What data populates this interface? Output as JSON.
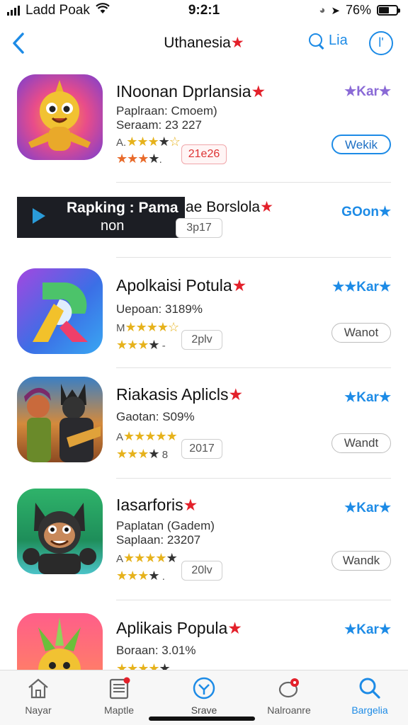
{
  "status": {
    "carrier": "Ladd Poak",
    "time": "9:2:1",
    "battery": "76%"
  },
  "nav": {
    "title": "Uthanesia",
    "search_label": "Lia"
  },
  "apps": [
    {
      "title": "INoonan Dprlansia",
      "sub1": "Paplraan: Cmoem)",
      "sub2": "Seraam: 23 227",
      "stars_prefix": "A.",
      "pill": "21e26",
      "rating": "Kar",
      "button": "Wekik"
    },
    {
      "banner_line1": "Rapking : Pama",
      "banner_line2": "non",
      "title": "ae Borslola",
      "pill": "3p17",
      "rating": "GOon"
    },
    {
      "title": "Apolkaisi Potula",
      "sub1": "Uepoan: 3189%",
      "stars_prefix": "M",
      "pill": "2plv",
      "rating": "Kar",
      "button": "Wanot"
    },
    {
      "title": "Riakasis Aplicls",
      "sub1": "Gaotan: S09%",
      "stars_prefix": "A",
      "pill": "2017",
      "rating": "Kar",
      "button": "Wandt"
    },
    {
      "title": "Iasarforis",
      "sub1": "Paplatan (Gadem)",
      "sub2": "Saplaan: 23207",
      "stars_prefix": "A",
      "pill": "20lv",
      "rating": "Kar",
      "button": "Wandk"
    },
    {
      "title": "Aplikais Popula",
      "sub1": "Boraan: 3.01%",
      "rating": "Kar"
    }
  ],
  "tabs": [
    {
      "label": "Nayar"
    },
    {
      "label": "Maptle"
    },
    {
      "label": "Srave"
    },
    {
      "label": "Nalroanre"
    },
    {
      "label": "Bargelia"
    }
  ],
  "colors": {
    "accent": "#1d8be6",
    "red_star": "#e3202a",
    "star_gold": "#e6b21c"
  }
}
